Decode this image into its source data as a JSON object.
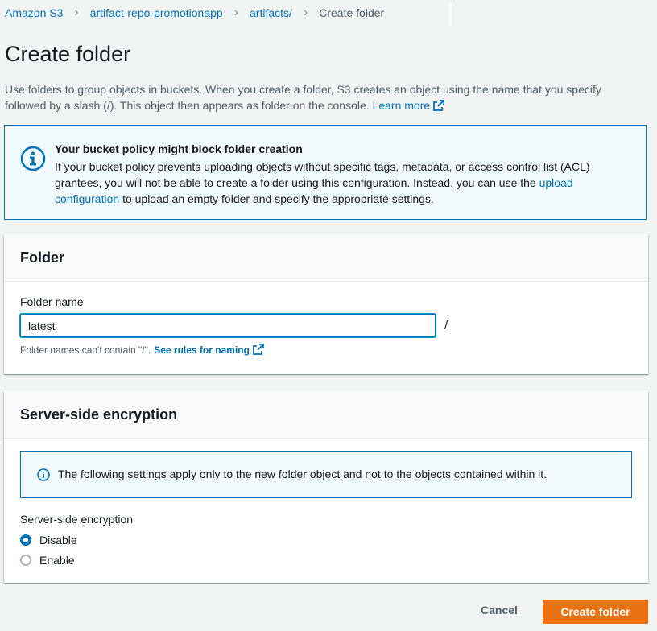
{
  "breadcrumb": {
    "items": [
      "Amazon S3",
      "artifact-repo-promotionapp",
      "artifacts/"
    ],
    "current": "Create folder"
  },
  "page": {
    "title": "Create folder",
    "description": "Use folders to group objects in buckets. When you create a folder, S3 creates an object using the name that you specify followed by a slash (/). This object then appears as folder on the console.",
    "learn_more": "Learn more"
  },
  "alert": {
    "title": "Your bucket policy might block folder creation",
    "body_before": "If your bucket policy prevents uploading objects without specific tags, metadata, or access control list (ACL) grantees, you will not be able to create a folder using this configuration. Instead, you can use the",
    "link": "upload configuration",
    "body_after": "to upload an empty folder and specify the appropriate settings."
  },
  "folder_panel": {
    "header": "Folder",
    "field_label": "Folder name",
    "field_value": "latest",
    "suffix": "/",
    "hint": "Folder names can't contain \"/\".",
    "hint_link": "See rules for naming"
  },
  "sse_panel": {
    "header": "Server-side encryption",
    "note": "The following settings apply only to the new folder object and not to the objects contained within it.",
    "field_label": "Server-side encryption",
    "options": [
      "Disable",
      "Enable"
    ],
    "selected": "Disable"
  },
  "actions": {
    "cancel": "Cancel",
    "create": "Create folder"
  },
  "colors": {
    "link": "#0073bb",
    "primary": "#ec7211",
    "info_bg": "#f1faff"
  }
}
